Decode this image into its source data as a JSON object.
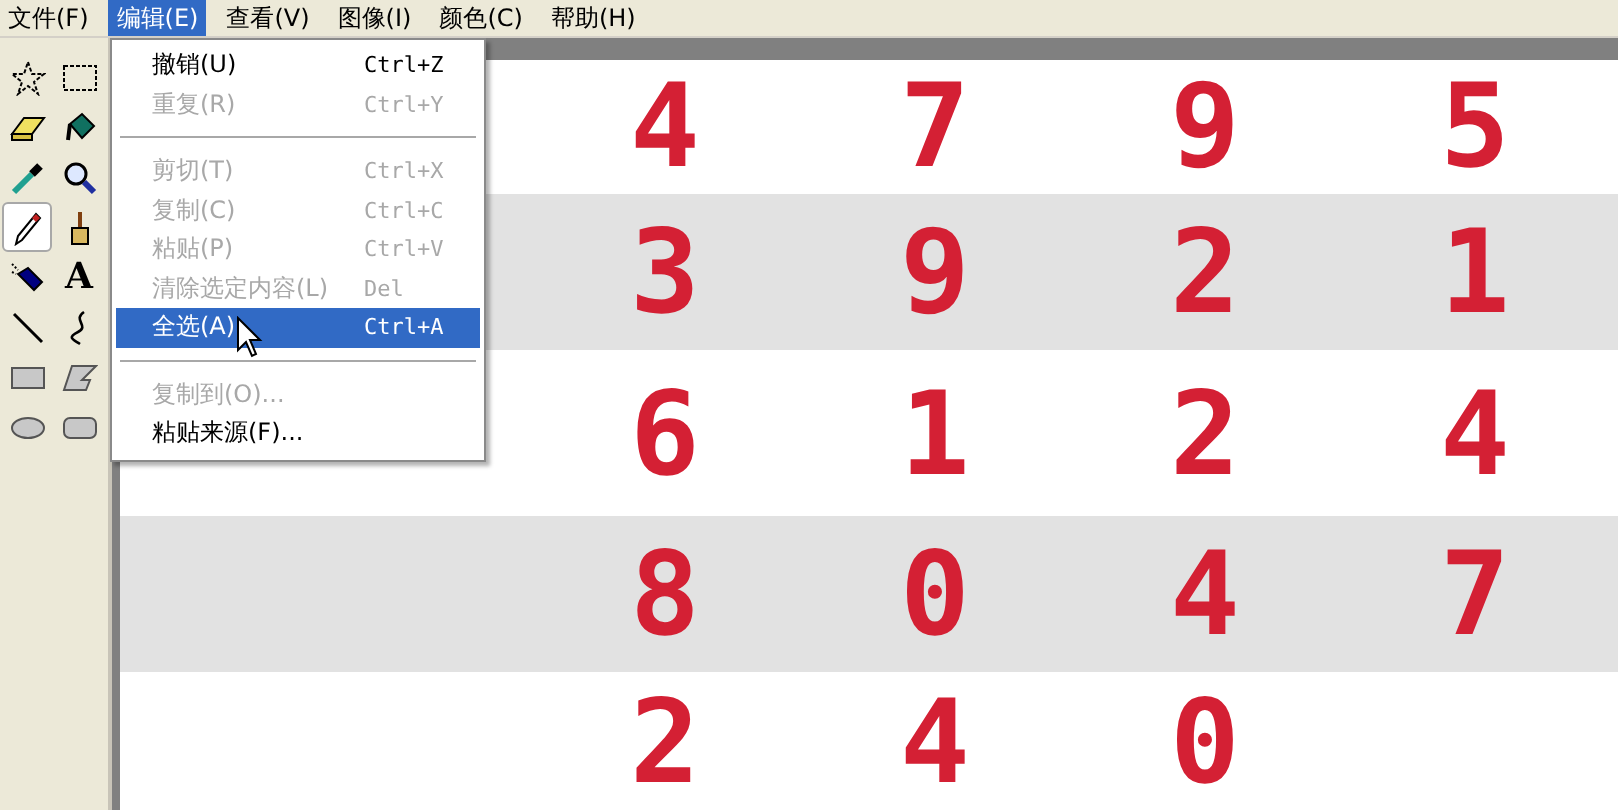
{
  "menu_bar": [
    {
      "label": "文件(F)",
      "selected": false
    },
    {
      "label": "编辑(E)",
      "selected": true
    },
    {
      "label": "查看(V)",
      "selected": false
    },
    {
      "label": "图像(I)",
      "selected": false
    },
    {
      "label": "颜色(C)",
      "selected": false
    },
    {
      "label": "帮助(H)",
      "selected": false
    }
  ],
  "tools": [
    {
      "selected": false
    },
    {
      "selected": false
    },
    {
      "selected": false
    },
    {
      "selected": false
    },
    {
      "selected": false
    },
    {
      "selected": false
    },
    {
      "selected": true
    },
    {
      "selected": false
    },
    {
      "selected": false
    },
    {
      "selected": false,
      "glyph": "A"
    },
    {
      "selected": false
    },
    {
      "selected": false
    },
    {
      "selected": false
    },
    {
      "selected": false
    },
    {
      "selected": false
    },
    {
      "selected": false
    }
  ],
  "edit_menu": [
    {
      "kind": "item",
      "label": "撤销(U)",
      "shortcut": "Ctrl+Z",
      "disabled": false,
      "selected": false
    },
    {
      "kind": "item",
      "label": "重复(R)",
      "shortcut": "Ctrl+Y",
      "disabled": true,
      "selected": false
    },
    {
      "kind": "separator"
    },
    {
      "kind": "item",
      "label": "剪切(T)",
      "shortcut": "Ctrl+X",
      "disabled": true,
      "selected": false
    },
    {
      "kind": "item",
      "label": "复制(C)",
      "shortcut": "Ctrl+C",
      "disabled": true,
      "selected": false
    },
    {
      "kind": "item",
      "label": "粘贴(P)",
      "shortcut": "Ctrl+V",
      "disabled": true,
      "selected": false
    },
    {
      "kind": "item",
      "label": "清除选定内容(L)",
      "shortcut": "Del",
      "disabled": true,
      "selected": false
    },
    {
      "kind": "item",
      "label": "全选(A)",
      "shortcut": "Ctrl+A",
      "disabled": false,
      "selected": true
    },
    {
      "kind": "separator"
    },
    {
      "kind": "item",
      "label": "复制到(O)...",
      "disabled": true,
      "selected": false
    },
    {
      "kind": "item",
      "label": "粘贴来源(F)...",
      "disabled": false,
      "selected": false
    }
  ],
  "canvas_rows": [
    {
      "shaded": false,
      "digits": [
        "4",
        "7",
        "9",
        "5"
      ]
    },
    {
      "shaded": true,
      "digits": [
        "3",
        "9",
        "2",
        "1"
      ]
    },
    {
      "shaded": false,
      "digits": [
        "6",
        "1",
        "2",
        "4"
      ]
    },
    {
      "shaded": true,
      "digits": [
        "8",
        "0",
        "4",
        "7"
      ]
    },
    {
      "shaded": false,
      "digits": [
        "2",
        "4",
        "0"
      ]
    }
  ]
}
